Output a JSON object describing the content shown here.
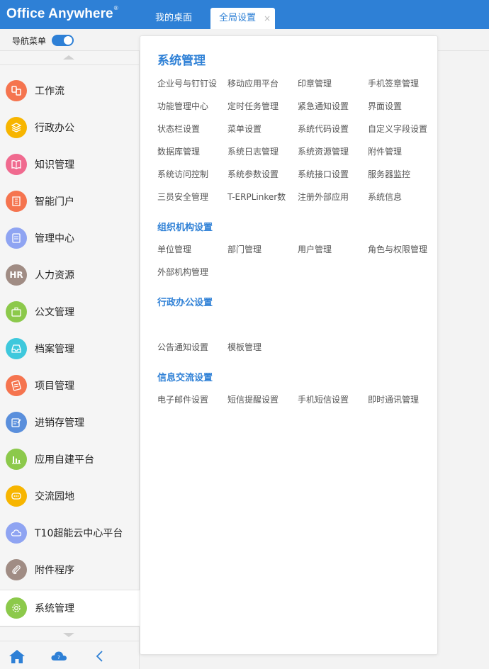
{
  "header": {
    "logo": "Office Anywhere",
    "logo_mark": "®",
    "tabs": [
      {
        "label": "我的桌面"
      },
      {
        "label": "全局设置"
      }
    ],
    "close_glyph": "×"
  },
  "subbar": {
    "nav_toggle_label": "导航菜单",
    "nav_toggle_on": true
  },
  "sidebar": {
    "items": [
      {
        "label": "工作流",
        "icon": "workflow-icon",
        "color": "#f5744f"
      },
      {
        "label": "行政办公",
        "icon": "layers-icon",
        "color": "#f7b500"
      },
      {
        "label": "知识管理",
        "icon": "book-icon",
        "color": "#f06a8f"
      },
      {
        "label": "智能门户",
        "icon": "building-icon",
        "color": "#f5744f"
      },
      {
        "label": "管理中心",
        "icon": "document-icon",
        "color": "#8fa4f2"
      },
      {
        "label": "人力资源",
        "icon": "hr-icon",
        "icon_text": "HR",
        "color": "#a08c84"
      },
      {
        "label": "公文管理",
        "icon": "briefcase-icon",
        "color": "#8cc94b"
      },
      {
        "label": "档案管理",
        "icon": "inbox-icon",
        "color": "#3ec8dc"
      },
      {
        "label": "项目管理",
        "icon": "checklist-icon",
        "color": "#f5744f"
      },
      {
        "label": "进销存管理",
        "icon": "edit-note-icon",
        "color": "#5a8fdc"
      },
      {
        "label": "应用自建平台",
        "icon": "bar-chart-icon",
        "color": "#8cc94b"
      },
      {
        "label": "交流园地",
        "icon": "chat-icon",
        "color": "#f7b500"
      },
      {
        "label": "T10超能云中心平台",
        "icon": "cloud-icon",
        "color": "#8fa4f2"
      },
      {
        "label": "附件程序",
        "icon": "paperclip-icon",
        "color": "#a08c84"
      },
      {
        "label": "系统管理",
        "icon": "gear-icon",
        "color": "#8cc94b",
        "active": true
      }
    ]
  },
  "panel": {
    "title": "系统管理",
    "system_links": [
      "企业号与钉钉设",
      "移动应用平台",
      "印章管理",
      "手机签章管理",
      "功能管理中心",
      "定时任务管理",
      "紧急通知设置",
      "界面设置",
      "状态栏设置",
      "菜单设置",
      "系统代码设置",
      "自定义字段设置",
      "数据库管理",
      "系统日志管理",
      "系统资源管理",
      "附件管理",
      "系统访问控制",
      "系统参数设置",
      "系统接口设置",
      "服务器监控",
      "三员安全管理",
      "T-ERPLinker数",
      "注册外部应用",
      "系统信息"
    ],
    "sections": [
      {
        "title": "组织机构设置",
        "links": [
          "单位管理",
          "部门管理",
          "用户管理",
          "角色与权限管理",
          "外部机构管理"
        ]
      },
      {
        "title": "行政办公设置",
        "links": [
          "公告通知设置",
          "模板管理"
        ]
      },
      {
        "title": "信息交流设置",
        "links": [
          "电子邮件设置",
          "短信提醒设置",
          "手机短信设置",
          "即时通讯管理"
        ]
      }
    ]
  },
  "colors": {
    "accent": "#2e80d6"
  }
}
